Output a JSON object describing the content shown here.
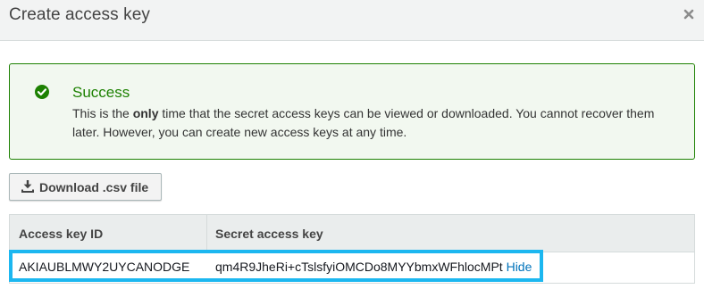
{
  "dialog": {
    "title": "Create access key"
  },
  "alert": {
    "title": "Success",
    "body_before": "This is the ",
    "body_emphasis": "only",
    "body_after": " time that the secret access keys can be viewed or downloaded. You cannot recover them later. However, you can create new access keys at any time.",
    "status_color": "#1d8102"
  },
  "actions": {
    "download_label": "Download .csv file"
  },
  "table": {
    "headers": [
      "Access key ID",
      "Secret access key"
    ],
    "rows": [
      {
        "access_key_id": "AKIAUBLMWY2UYCANODGE",
        "secret_access_key": "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",
        "toggle_label": "Hide"
      }
    ]
  },
  "colors": {
    "highlight": "#1cb7f0",
    "link": "#0073bb"
  },
  "icons": {
    "close": "close-icon",
    "success": "check-circle-icon",
    "download": "download-icon"
  }
}
